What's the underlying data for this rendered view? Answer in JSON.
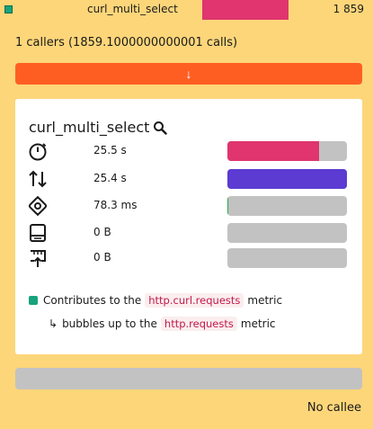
{
  "topbar": {
    "name": "curl_multi_select",
    "count": "1 859",
    "accent": "#e0356e",
    "square_color": "#17a37c"
  },
  "callers": {
    "text": "1 callers (1859.1000000000001 calls)"
  },
  "up_button": {
    "label": "↓",
    "color": "#ff5e23"
  },
  "card": {
    "function_name": "curl_multi_select",
    "search_icon": "magnifier-icon",
    "metrics": [
      {
        "icon": "timer-icon",
        "value": "25.5 s",
        "fill_fraction": 0.77,
        "color": "#e0356e"
      },
      {
        "icon": "swap-vertical-icon",
        "value": "25.4 s",
        "fill_fraction": 1.0,
        "color": "#5b3bd1"
      },
      {
        "icon": "cpu-chip-icon",
        "value": "78.3 ms",
        "fill_fraction": 0.01,
        "color": "#2da84b"
      },
      {
        "icon": "memory-drive-icon",
        "value": "0 B",
        "fill_fraction": 0.0,
        "color": "#c2c2c2"
      },
      {
        "icon": "network-upload-icon",
        "value": "0 B",
        "fill_fraction": 0.0,
        "color": "#c2c2c2"
      }
    ],
    "contributes": {
      "prefix": "Contributes to the",
      "metric": "http.curl.requests",
      "suffix": "metric"
    },
    "bubbles": {
      "arrow": "↳",
      "prefix": "bubbles up to the",
      "metric": "http.requests",
      "suffix": "metric"
    }
  },
  "footer": {
    "no_callee": "No callee"
  }
}
